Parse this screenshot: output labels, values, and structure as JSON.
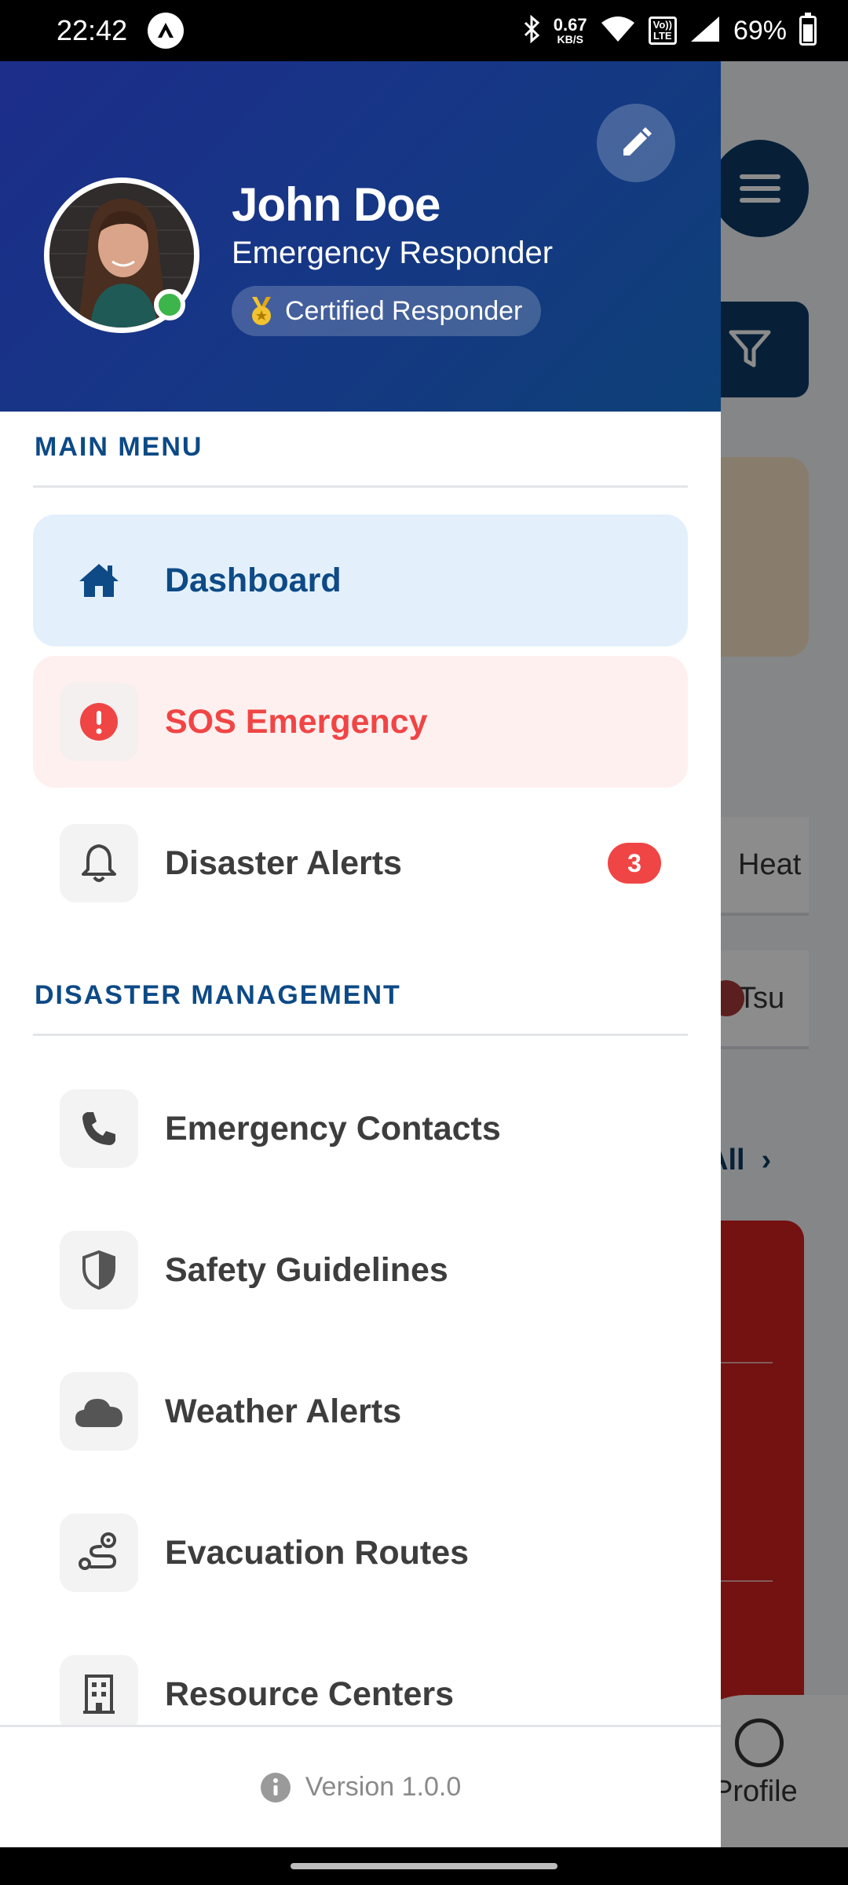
{
  "status_bar": {
    "time": "22:42",
    "net_speed_value": "0.67",
    "net_speed_unit": "KB/S",
    "volte_top": "Vo))",
    "volte_bottom": "LTE",
    "battery": "69%"
  },
  "profile": {
    "name": "John Doe",
    "role": "Emergency Responder",
    "badge": "Certified Responder",
    "status": "online"
  },
  "sections": {
    "main_menu": "MAIN MENU",
    "disaster_management": "DISASTER MANAGEMENT"
  },
  "menu": {
    "dashboard": "Dashboard",
    "sos": "SOS Emergency",
    "alerts": "Disaster Alerts",
    "alerts_badge": "3",
    "contacts": "Emergency Contacts",
    "guidelines": "Safety Guidelines",
    "weather": "Weather Alerts",
    "evacuation": "Evacuation Routes",
    "resources": "Resource Centers"
  },
  "footer": {
    "version": "Version 1.0.0"
  },
  "background": {
    "chip_1": "Heat",
    "chip_2": "Tsu",
    "view_all": "All",
    "nav_profile": "Profile"
  },
  "colors": {
    "primary": "#0d4a86",
    "header_gradient_start": "#1c2d8a",
    "header_gradient_end": "#0e4077",
    "danger": "#f04545",
    "active_bg": "#e3f0fc",
    "sos_bg": "#fff0f0",
    "online": "#3cb54a"
  }
}
